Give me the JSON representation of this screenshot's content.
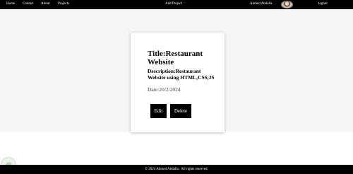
{
  "navbar": {
    "links": [
      "Home",
      "Contact",
      "About",
      "Projects"
    ],
    "add_project": "Add Project",
    "user_name": "Ahmed Abdalla",
    "logout": "logout"
  },
  "project": {
    "title": "Title:Restaurant Website",
    "description": "Description:Restaurant Website using HTML,CSS,JS",
    "date": "Date:20/2/2024",
    "edit_label": "Edit",
    "delete_label": "Delete"
  },
  "footer": {
    "text": "© 2024 Ahmed Abdalla . All rights reserved."
  },
  "icons": {
    "avatar": "avatar",
    "floating_button": "circle-icon"
  }
}
